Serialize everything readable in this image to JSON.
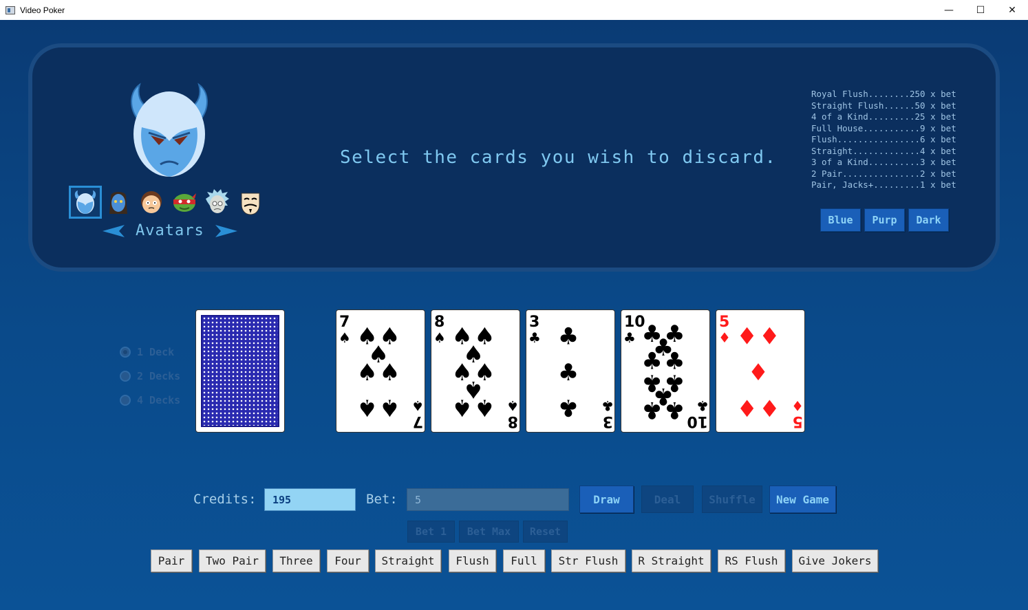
{
  "window": {
    "title": "Video Poker",
    "minimize": "—",
    "maximize": "☐",
    "close": "✕"
  },
  "header": {
    "message": "Select the cards you wish to discard.",
    "avatars": {
      "label": "Avatars",
      "selected_index": 0,
      "items": [
        "blue-demon-avatar",
        "navi-avatar",
        "morty-avatar",
        "ninja-turtle-avatar",
        "rick-avatar",
        "guy-fawkes-avatar"
      ]
    },
    "paytable": [
      "Royal Flush........250 x bet",
      "Straight Flush......50 x bet",
      "4 of a Kind.........25 x bet",
      "Full House...........9 x bet",
      "Flush................6 x bet",
      "Straight.............4 x bet",
      "3 of a Kind..........3 x bet",
      "2 Pair...............2 x bet",
      "Pair, Jacks+.........1 x bet"
    ],
    "themes": [
      "Blue",
      "Purp",
      "Dark"
    ]
  },
  "deck_options": {
    "selected": "1 Deck",
    "items": [
      "1 Deck",
      "2 Decks",
      "4 Decks"
    ]
  },
  "hand": [
    {
      "rank": "7",
      "suit": "spades",
      "color": "#000000"
    },
    {
      "rank": "8",
      "suit": "spades",
      "color": "#000000"
    },
    {
      "rank": "3",
      "suit": "clubs",
      "color": "#000000"
    },
    {
      "rank": "10",
      "suit": "clubs",
      "color": "#000000"
    },
    {
      "rank": "5",
      "suit": "diamonds",
      "color": "#ff1a1a"
    }
  ],
  "controls": {
    "credits_label": "Credits:",
    "credits_value": "195",
    "bet_label": "Bet:",
    "bet_value": "5",
    "draw": "Draw",
    "deal": "Deal",
    "shuffle": "Shuffle",
    "new_game": "New Game",
    "bet_1": "Bet 1",
    "bet_max": "Bet Max",
    "reset": "Reset"
  },
  "hand_buttons": [
    "Pair",
    "Two Pair",
    "Three",
    "Four",
    "Straight",
    "Flush",
    "Full",
    "Str Flush",
    "R Straight",
    "RS Flush",
    "Give Jokers"
  ],
  "colors": {
    "accent": "#1a5fb8",
    "accent_text": "#8dd3f7",
    "panel": "#0b2f5e",
    "background": "#0a4a8a"
  }
}
